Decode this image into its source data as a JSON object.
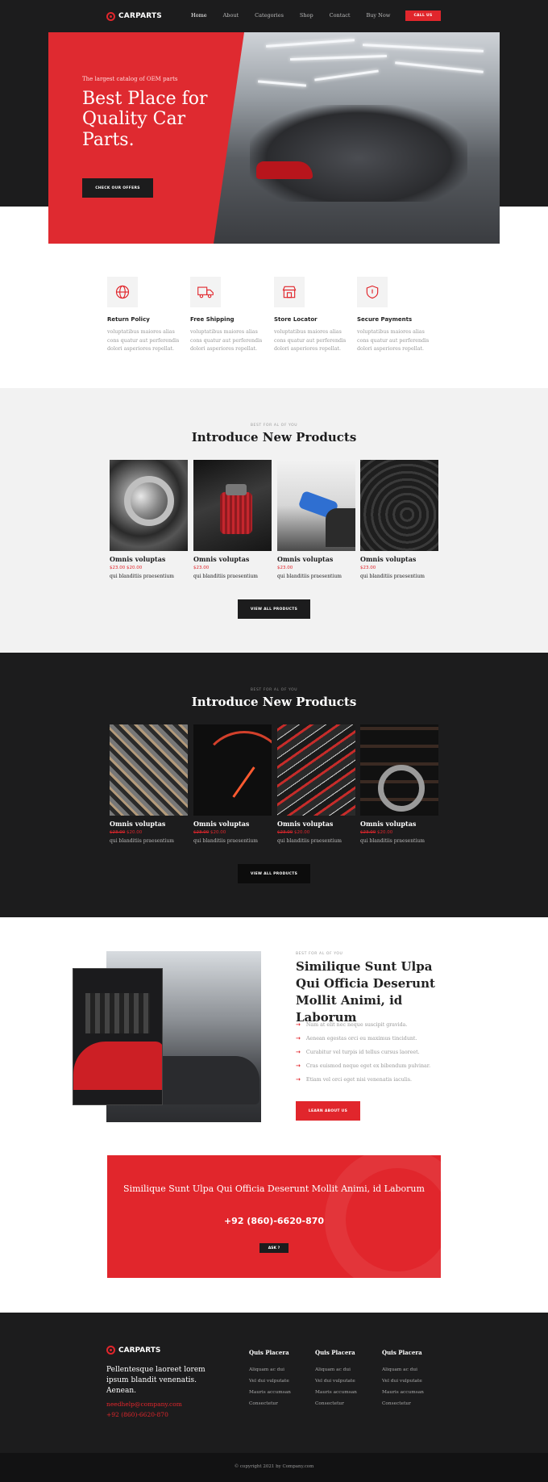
{
  "header": {
    "logo": "CARPARTS",
    "nav": [
      "Home",
      "About",
      "Categories",
      "Shop",
      "Contact",
      "Buy Now"
    ],
    "call_label": "CALL US"
  },
  "hero": {
    "subtitle": "The largest catalog of OEM parts",
    "title": "Best Place for Quality Car Parts.",
    "button": "CHECK OUR OFFERS"
  },
  "features": [
    {
      "icon": "globe-icon",
      "title": "Return Policy",
      "text": "voluptatibus maiores alias cons quatur aut perferendis dolori asperiores repellat."
    },
    {
      "icon": "truck-icon",
      "title": "Free Shipping",
      "text": "voluptatibus maiores alias cons quatur aut perferendis dolori asperiores repellat."
    },
    {
      "icon": "store-icon",
      "title": "Store Locator",
      "text": "voluptatibus maiores alias cons quatur aut perferendis dolori asperiores repellat."
    },
    {
      "icon": "shield-icon",
      "title": "Secure Payments",
      "text": "voluptatibus maiores alias cons quatur aut perferendis dolori asperiores repellat."
    }
  ],
  "products1": {
    "kicker": "BEST FOR AL OF YOU",
    "title": "Introduce New Products",
    "items": [
      {
        "image": "wheel-rim-photo",
        "name": "Omnis voluptas",
        "price_old": "",
        "price": "$23.00 $20.00",
        "desc": "qui blanditiis praesentium"
      },
      {
        "image": "air-filter-photo",
        "name": "Omnis voluptas",
        "price_old": "",
        "price": "$23.00",
        "desc": "qui blanditiis praesentium"
      },
      {
        "image": "fuel-nozzle-photo",
        "name": "Omnis voluptas",
        "price_old": "",
        "price": "$23.00",
        "desc": "qui blanditiis praesentium"
      },
      {
        "image": "tires-photo",
        "name": "Omnis voluptas",
        "price_old": "",
        "price": "$23.00",
        "desc": "qui blanditiis praesentium"
      }
    ],
    "button": "VIEW ALL PRODUCTS"
  },
  "products2": {
    "kicker": "BEST FOR AL OF YOU",
    "title": "Introduce New Products",
    "items": [
      {
        "image": "engine-photo",
        "name": "Omnis voluptas",
        "price_old": "$23.00",
        "price": "$20.00",
        "desc": "qui blanditiis praesentium"
      },
      {
        "image": "speedometer-photo",
        "name": "Omnis voluptas",
        "price_old": "$23.00",
        "price": "$20.00",
        "desc": "qui blanditiis praesentium"
      },
      {
        "image": "jumper-cables-photo",
        "name": "Omnis voluptas",
        "price_old": "$23.00",
        "price": "$20.00",
        "desc": "qui blanditiis praesentium"
      },
      {
        "image": "rims-rack-photo",
        "name": "Omnis voluptas",
        "price_old": "$23.00",
        "price": "$20.00",
        "desc": "qui blanditiis praesentium"
      }
    ],
    "button": "VIEW ALL PRODUCTS"
  },
  "about": {
    "kicker": "BEST FOR AL OF YOU",
    "title": "Similique Sunt Ulpa Qui Officia Deserunt Mollit Animi, id Laborum",
    "list": [
      "Nam at elit nec neque suscipit gravida.",
      "Aenean egestas orci eu maximus tincidunt.",
      "Curabitur vel turpis id tellus cursus laoreet.",
      "Cras euismod neque eget ex bibendum pulvinar.",
      "Etiam vel orci eget nisi venenatis iaculis."
    ],
    "button": "LEARN ABOUT US"
  },
  "cta": {
    "text": "Similique Sunt Ulpa Qui Officia Deserunt Mollit Animi, id Laborum",
    "phone": "+92 (860)-6620-870",
    "button": "ASK ?"
  },
  "footer": {
    "logo": "CARPARTS",
    "desc": "Pellentesque laoreet lorem ipsum blandit venenatis. Aenean.",
    "email": "needhelp@company.com",
    "phone": "+92 (860)-6620-870",
    "columns": [
      {
        "title": "Quis Placera",
        "items": [
          "Aliquam ac dui",
          "Vel dui vulputate",
          "Mauris accumsan",
          "Consectetur"
        ]
      },
      {
        "title": "Quis Placera",
        "items": [
          "Aliquam ac dui",
          "Vel dui vulputate",
          "Mauris accumsan",
          "Consectetur"
        ]
      },
      {
        "title": "Quis Placera",
        "items": [
          "Aliquam ac dui",
          "Vel dui vulputate",
          "Mauris accumsan",
          "Consectetur"
        ]
      }
    ],
    "copyright": "© copyright 2021 by Company.com"
  },
  "colors": {
    "accent": "#e1262c",
    "dark": "#1c1c1d",
    "light": "#f2f2f2"
  }
}
